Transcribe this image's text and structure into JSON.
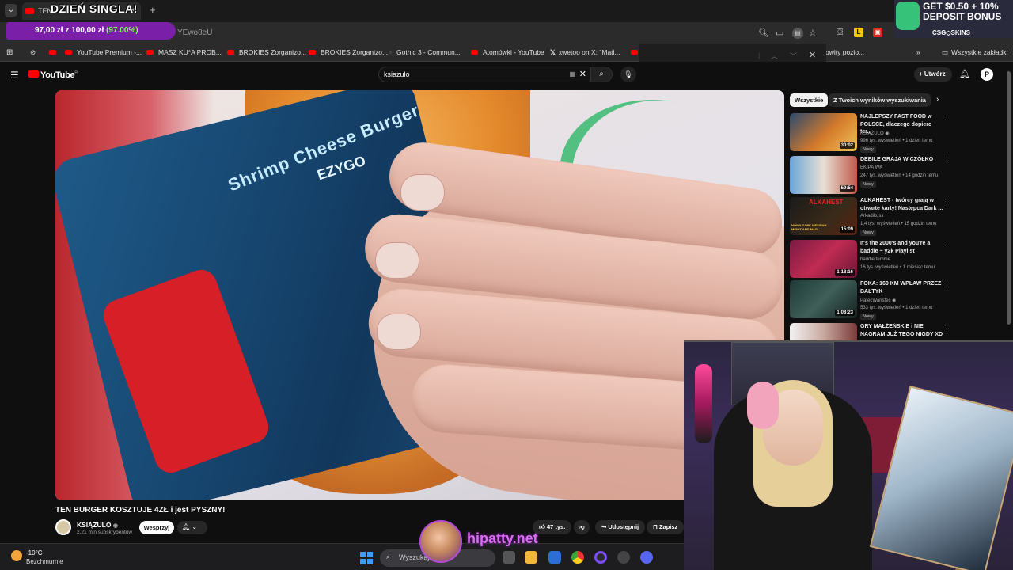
{
  "browser": {
    "tab_title": "TEN",
    "url_fragment": "YEwo8eU",
    "bookmarks": [
      {
        "label": "YouTube Premium -..."
      },
      {
        "label": "MASZ KU*A PROB..."
      },
      {
        "label": "BROKIES Zorganizo..."
      },
      {
        "label": "BROKIES Zorganizo..."
      },
      {
        "label": "Gothic 3 - Commun..."
      },
      {
        "label": "Atomówki - YouTube"
      },
      {
        "label": "xwetoo on X: \"Mati..."
      },
      {
        "label": "owity pozio..."
      }
    ],
    "all_bookmarks": "Wszystkie zakładki"
  },
  "overlay": {
    "banner": "DZIEŃ SINGLA!",
    "goal_amount": "97,00 zł z 100,00 zł",
    "goal_percent": "(97.00%)",
    "promo_line1": "GET $0.50 + 10%",
    "promo_line2": "DEPOSIT BONUS",
    "promo_brand": "CSG◇SKINS",
    "streamer_name": "hipatty.net"
  },
  "youtube": {
    "logo_text": "YouTube",
    "logo_region": "PL",
    "search_value": "ksiazulo",
    "create_label": "Utwórz",
    "avatar_letter": "P"
  },
  "video": {
    "title": "TEN BURGER KOSZTUJE 4ZŁ i jest PYSZNY!",
    "wrapper_text_1": "Shrimp Cheese Burger",
    "wrapper_text_2": "EZYGO",
    "channel": "KSIĄŻULO",
    "subscribers": "2,21 mln subskrybentów",
    "support_label": "Wesprzyj",
    "likes": "47 tys.",
    "share_label": "Udostępnij",
    "save_label": "Zapisz"
  },
  "sidebar": {
    "chips": [
      "Wszystkie",
      "Z Twoich wyników wyszukiwania"
    ],
    "recommendations": [
      {
        "title": "NAJLEPSZY FAST FOOD w POLSCE, dlaczego dopiero ter...",
        "channel": "KSIĄŻULO",
        "meta": "996 tys. wyświetleń • 1 dzień temu",
        "badge": "Nowy",
        "duration": "30:02"
      },
      {
        "title": "DEBILE GRAJĄ W CZÓŁKO",
        "channel": "EKIPA WK",
        "meta": "247 tys. wyświetleń • 14 godzin temu",
        "badge": "Nowy",
        "duration": "59:54"
      },
      {
        "title": "ALKAHEST - twórcy grają w otwarte karty! Następca Dark ...",
        "channel": "Arkadikuss",
        "meta": "1,4 tys. wyświetleń • 15 godzin temu",
        "badge": "Nowy",
        "duration": "15:09",
        "thumb_text": "ALKAHEST",
        "thumb_sub": "NOWY DARK MESSIAH MIGHT AND MAG..."
      },
      {
        "title": "It's the 2000's and you're a baddie ~ y2k Playlist",
        "channel": "baddie femme",
        "meta": "16 tys. wyświetleń • 1 miesiąc temu",
        "badge": "",
        "duration": "1:18:16"
      },
      {
        "title": "FOKA: 160 KM WPŁAW PRZEZ BAŁTYK",
        "channel": "PatecWaristec",
        "meta": "533 tys. wyświetleń • 1 dzień temu",
        "badge": "Nowy",
        "duration": "1:08:23"
      },
      {
        "title": "GRY MAŁŻEŃSKIE i NIE NAGRAM JUŻ TEGO NIGDY XD",
        "channel": "",
        "meta": "",
        "badge": "",
        "duration": ""
      }
    ]
  },
  "taskbar": {
    "temperature": "-10°C",
    "condition": "Bezchmurnie",
    "search_placeholder": "Wyszukaj"
  }
}
